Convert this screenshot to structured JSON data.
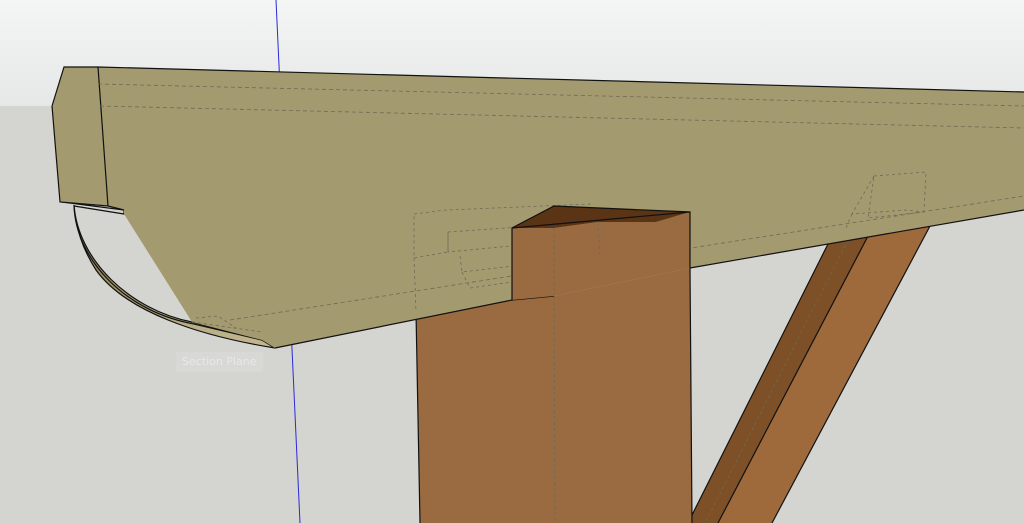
{
  "viewport": {
    "sky_color": "#e5e6e6",
    "ground_color": "#d4d4d1",
    "axis_color": "#2b2bd6"
  },
  "model": {
    "beam_color": "#a39a6f",
    "beam_underside_color": "#b0a47b",
    "post_color": "#9a6a40",
    "brace_light_color": "#9e6a3c",
    "brace_dark_color": "#7d5028",
    "edge_color": "#111111",
    "hidden_edge_color": "#6f6a55"
  },
  "tooltip": {
    "text": "Section Plane"
  }
}
